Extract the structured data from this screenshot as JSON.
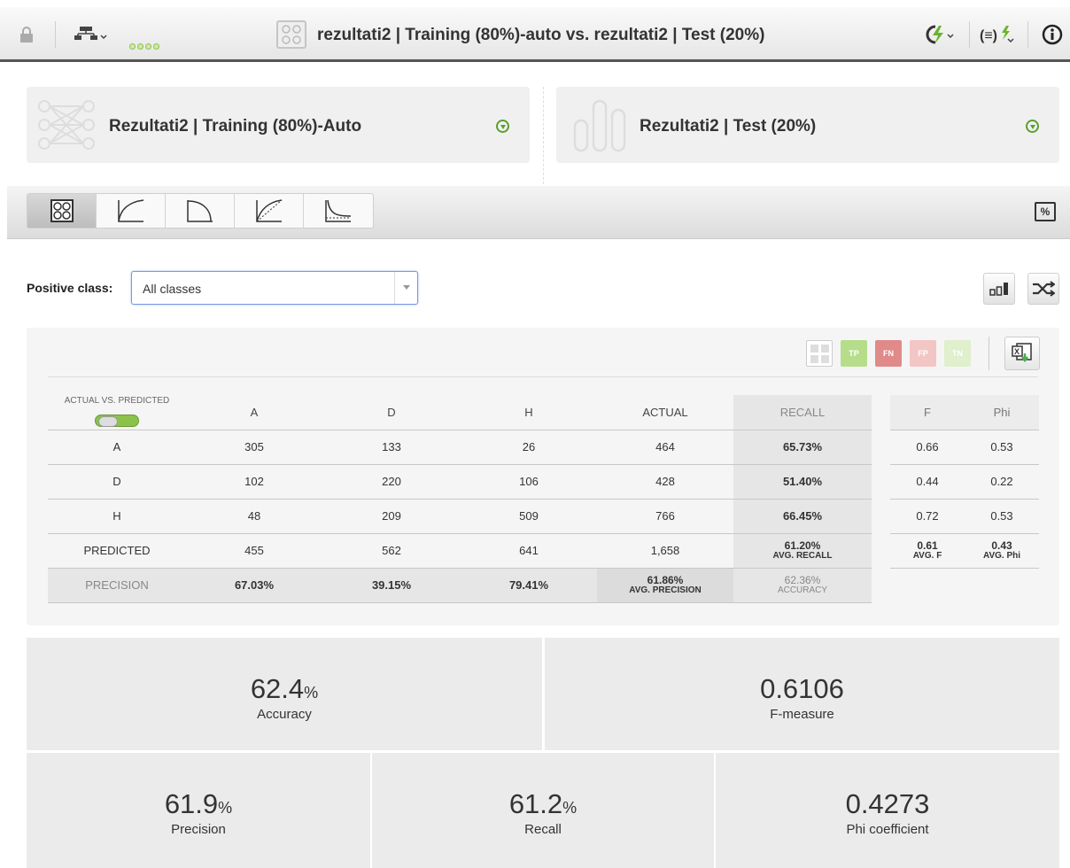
{
  "topbar": {
    "title": "rezultati2 | Training (80%)-auto vs. rezultati2 | Test (20%)",
    "icons": [
      "lock-icon",
      "tree-menu-icon",
      "progress-dots-icon",
      "evaluation-icon",
      "actions-lightning-icon",
      "formula-lightning-icon",
      "info-icon"
    ]
  },
  "cards": {
    "left_title": "Rezultati2 | Training (80%)-Auto",
    "right_title": "Rezultati2 | Test (20%)"
  },
  "tabs": [
    "confusion-matrix",
    "roc-curve",
    "precision-recall-curve",
    "gain-curve",
    "lift-curve"
  ],
  "positive_class": {
    "label": "Positive class:",
    "value": "All classes"
  },
  "legend": {
    "tp": "TP",
    "fn": "FN",
    "fp": "FP",
    "tn": "TN"
  },
  "matrix": {
    "corner": "ACTUAL VS. PREDICTED",
    "headers": [
      "A",
      "D",
      "H",
      "ACTUAL",
      "RECALL"
    ],
    "rows": [
      {
        "label": "A",
        "a": "305",
        "d": "133",
        "h": "26",
        "actual": "464",
        "recall": "65.73%"
      },
      {
        "label": "D",
        "a": "102",
        "d": "220",
        "h": "106",
        "actual": "428",
        "recall": "51.40%"
      },
      {
        "label": "H",
        "a": "48",
        "d": "209",
        "h": "509",
        "actual": "766",
        "recall": "66.45%"
      }
    ],
    "predicted": {
      "label": "PREDICTED",
      "a": "455",
      "d": "562",
      "h": "641",
      "actual": "1,658",
      "avg_recall": "61.20%",
      "avg_recall_label": "AVG. RECALL"
    },
    "precision": {
      "label": "PRECISION",
      "a": "67.03%",
      "d": "39.15%",
      "h": "79.41%",
      "avg_precision": "61.86%",
      "avg_precision_label": "AVG. PRECISION",
      "accuracy": "62.36%",
      "accuracy_label": "ACCURACY"
    }
  },
  "fphi": {
    "headers": [
      "F",
      "Phi"
    ],
    "rows": [
      [
        "0.66",
        "0.53"
      ],
      [
        "0.44",
        "0.22"
      ],
      [
        "0.72",
        "0.53"
      ]
    ],
    "avg": {
      "f": "0.61",
      "f_label": "AVG. F",
      "phi": "0.43",
      "phi_label": "AVG. Phi"
    }
  },
  "metrics": {
    "accuracy": {
      "value": "62.4",
      "unit": "%",
      "label": "Accuracy"
    },
    "fmeasure": {
      "value": "0.6106",
      "unit": "",
      "label": "F-measure"
    },
    "precision": {
      "value": "61.9",
      "unit": "%",
      "label": "Precision"
    },
    "recall": {
      "value": "61.2",
      "unit": "%",
      "label": "Recall"
    },
    "phi": {
      "value": "0.4273",
      "unit": "",
      "label": "Phi coefficient"
    }
  },
  "colors": {
    "accent_green": "#8bc34a",
    "tp": "#b6dd8a",
    "fn": "#e08a8a",
    "fp": "#f3c6c6",
    "tn": "#e0efcc"
  }
}
